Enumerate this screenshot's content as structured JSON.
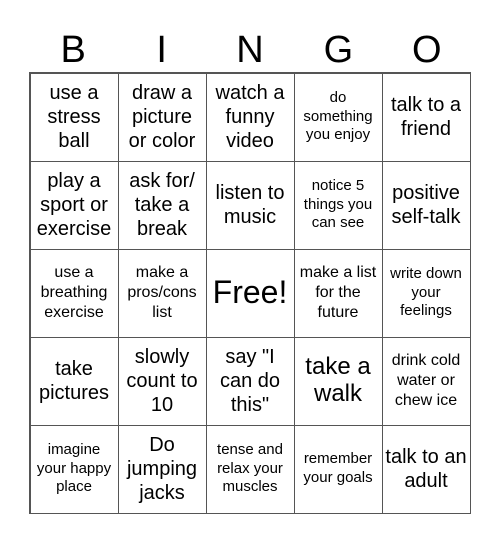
{
  "header": {
    "letters": [
      "B",
      "I",
      "N",
      "G",
      "O"
    ]
  },
  "cells": [
    {
      "text": "use a stress ball",
      "size": "m"
    },
    {
      "text": "draw a picture or color",
      "size": "m"
    },
    {
      "text": "watch a funny video",
      "size": "m"
    },
    {
      "text": "do something you enjoy",
      "size": "xs"
    },
    {
      "text": "talk to a friend",
      "size": "m"
    },
    {
      "text": "play a sport or exercise",
      "size": "m"
    },
    {
      "text": "ask for/ take a break",
      "size": "m"
    },
    {
      "text": "listen to music",
      "size": "m"
    },
    {
      "text": "notice 5 things you can see",
      "size": "xs"
    },
    {
      "text": "positive self-talk",
      "size": "m"
    },
    {
      "text": "use a breathing exercise",
      "size": "s"
    },
    {
      "text": "make a pros/cons list",
      "size": "s"
    },
    {
      "text": "Free!",
      "size": "xl"
    },
    {
      "text": "make a list for the future",
      "size": "s"
    },
    {
      "text": "write down your feelings",
      "size": "xs"
    },
    {
      "text": "take pictures",
      "size": "m"
    },
    {
      "text": "slowly count to 10",
      "size": "m"
    },
    {
      "text": "say \"I can do this\"",
      "size": "m"
    },
    {
      "text": "take a walk",
      "size": "l"
    },
    {
      "text": "drink cold water or chew ice",
      "size": "s"
    },
    {
      "text": "imagine your happy place",
      "size": "xs"
    },
    {
      "text": "Do jumping jacks",
      "size": "m"
    },
    {
      "text": "tense and relax your muscles",
      "size": "xs"
    },
    {
      "text": "remember your goals",
      "size": "xs"
    },
    {
      "text": "talk to an adult",
      "size": "m"
    }
  ]
}
